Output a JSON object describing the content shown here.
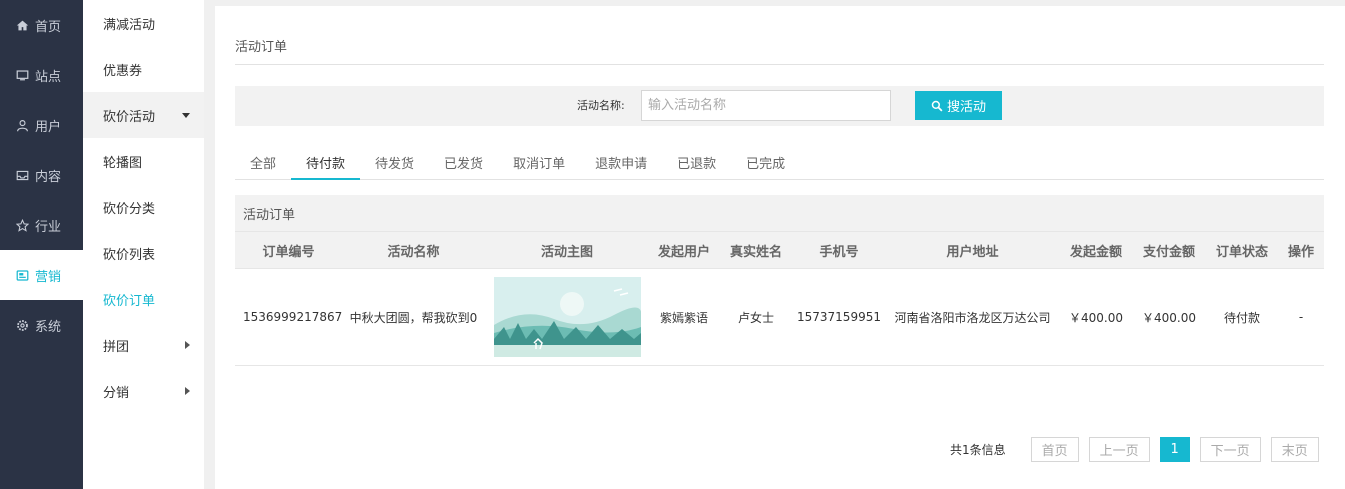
{
  "nav_primary": [
    {
      "label": "首页",
      "icon": "home-icon"
    },
    {
      "label": "站点",
      "icon": "monitor-icon"
    },
    {
      "label": "用户",
      "icon": "user-icon"
    },
    {
      "label": "内容",
      "icon": "inbox-icon"
    },
    {
      "label": "行业",
      "icon": "star-icon"
    },
    {
      "label": "营销",
      "icon": "marketing-icon",
      "active": true
    },
    {
      "label": "系统",
      "icon": "gear-icon"
    }
  ],
  "nav_secondary": [
    {
      "label": "满减活动"
    },
    {
      "label": "优惠券"
    },
    {
      "label": "砍价活动",
      "expanded": true
    },
    {
      "label": "轮播图"
    },
    {
      "label": "砍价分类"
    },
    {
      "label": "砍价列表"
    },
    {
      "label": "砍价订单",
      "current": true
    },
    {
      "label": "拼团"
    },
    {
      "label": "分销"
    }
  ],
  "page": {
    "title": "活动订单"
  },
  "search": {
    "label": "活动名称:",
    "placeholder": "输入活动名称",
    "value": "",
    "button_label": "搜活动"
  },
  "tabs": [
    "全部",
    "待付款",
    "待发货",
    "已发货",
    "取消订单",
    "退款申请",
    "已退款",
    "已完成"
  ],
  "active_tab": "待付款",
  "table": {
    "caption": "活动订单",
    "columns": [
      "订单编号",
      "活动名称",
      "活动主图",
      "发起用户",
      "真实姓名",
      "手机号",
      "用户地址",
      "发起金额",
      "支付金额",
      "订单状态",
      "操作"
    ],
    "rows": [
      {
        "order_no": "1536999217867",
        "activity_name": "中秋大团圆，帮我砍到0",
        "image": "landscape-thumbnail",
        "initiator": "紫嫣紫语",
        "real_name": "卢女士",
        "phone": "15737159951",
        "address": "河南省洛阳市洛龙区万达公司",
        "start_amount": "￥400.00",
        "paid_amount": "￥400.00",
        "status": "待付款",
        "action": "-"
      }
    ]
  },
  "pagination": {
    "info": "共1条信息",
    "first": "首页",
    "prev": "上一页",
    "current": "1",
    "next": "下一页",
    "last": "末页"
  },
  "colors": {
    "accent": "#16b8d0",
    "sidebar": "#2b3345"
  }
}
